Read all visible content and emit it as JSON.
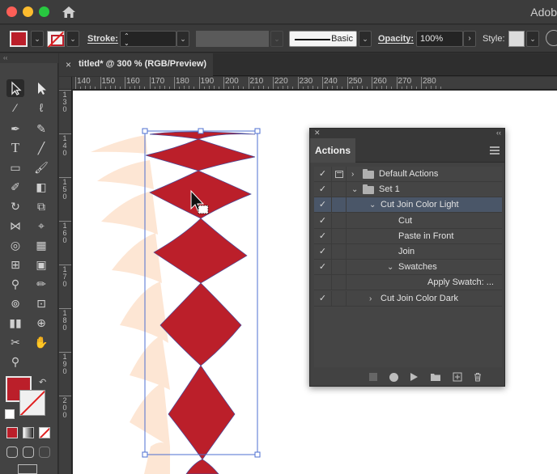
{
  "app": {
    "title": "Adob"
  },
  "control_bar": {
    "stroke_label": "Stroke:",
    "stroke_profile": "Basic",
    "opacity_label": "Opacity:",
    "opacity_value": "100%",
    "style_label": "Style:",
    "fill_color": "#bb1f2a"
  },
  "document": {
    "tab_title": "titled* @ 300 % (RGB/Preview)",
    "close_glyph": "×"
  },
  "ruler": {
    "h_labels": [
      "140",
      "150",
      "160",
      "170",
      "180",
      "190",
      "200",
      "210",
      "220",
      "230",
      "240",
      "250",
      "260",
      "270",
      "280"
    ],
    "v_labels": [
      "130",
      "140",
      "150",
      "160",
      "170",
      "180",
      "190",
      "200"
    ]
  },
  "panel": {
    "tab": "Actions",
    "rows": [
      {
        "checked": true,
        "dialog": true,
        "expanded": false,
        "folder": true,
        "label": "Default Actions",
        "level": 0
      },
      {
        "checked": true,
        "dialog": false,
        "expanded": true,
        "folder": true,
        "label": "Set 1",
        "level": 0
      },
      {
        "checked": true,
        "dialog": false,
        "expanded": true,
        "folder": false,
        "label": "Cut Join Color Light",
        "level": 1,
        "selected": true
      },
      {
        "checked": true,
        "dialog": false,
        "expanded": null,
        "folder": false,
        "label": "Cut",
        "level": 2
      },
      {
        "checked": true,
        "dialog": false,
        "expanded": null,
        "folder": false,
        "label": "Paste in Front",
        "level": 2
      },
      {
        "checked": true,
        "dialog": false,
        "expanded": null,
        "folder": false,
        "label": "Join",
        "level": 2
      },
      {
        "checked": true,
        "dialog": false,
        "expanded": true,
        "folder": false,
        "label": "Swatches",
        "level": 2
      },
      {
        "checked": false,
        "dialog": false,
        "expanded": null,
        "folder": false,
        "label": "Apply Swatch: ...",
        "level": 3
      },
      {
        "checked": true,
        "dialog": false,
        "expanded": false,
        "folder": false,
        "label": "Cut Join Color Dark",
        "level": 1
      }
    ]
  },
  "colors": {
    "accent_red": "#bb1f2a",
    "peach": "#fde6d4",
    "selection": "#4a5668"
  }
}
